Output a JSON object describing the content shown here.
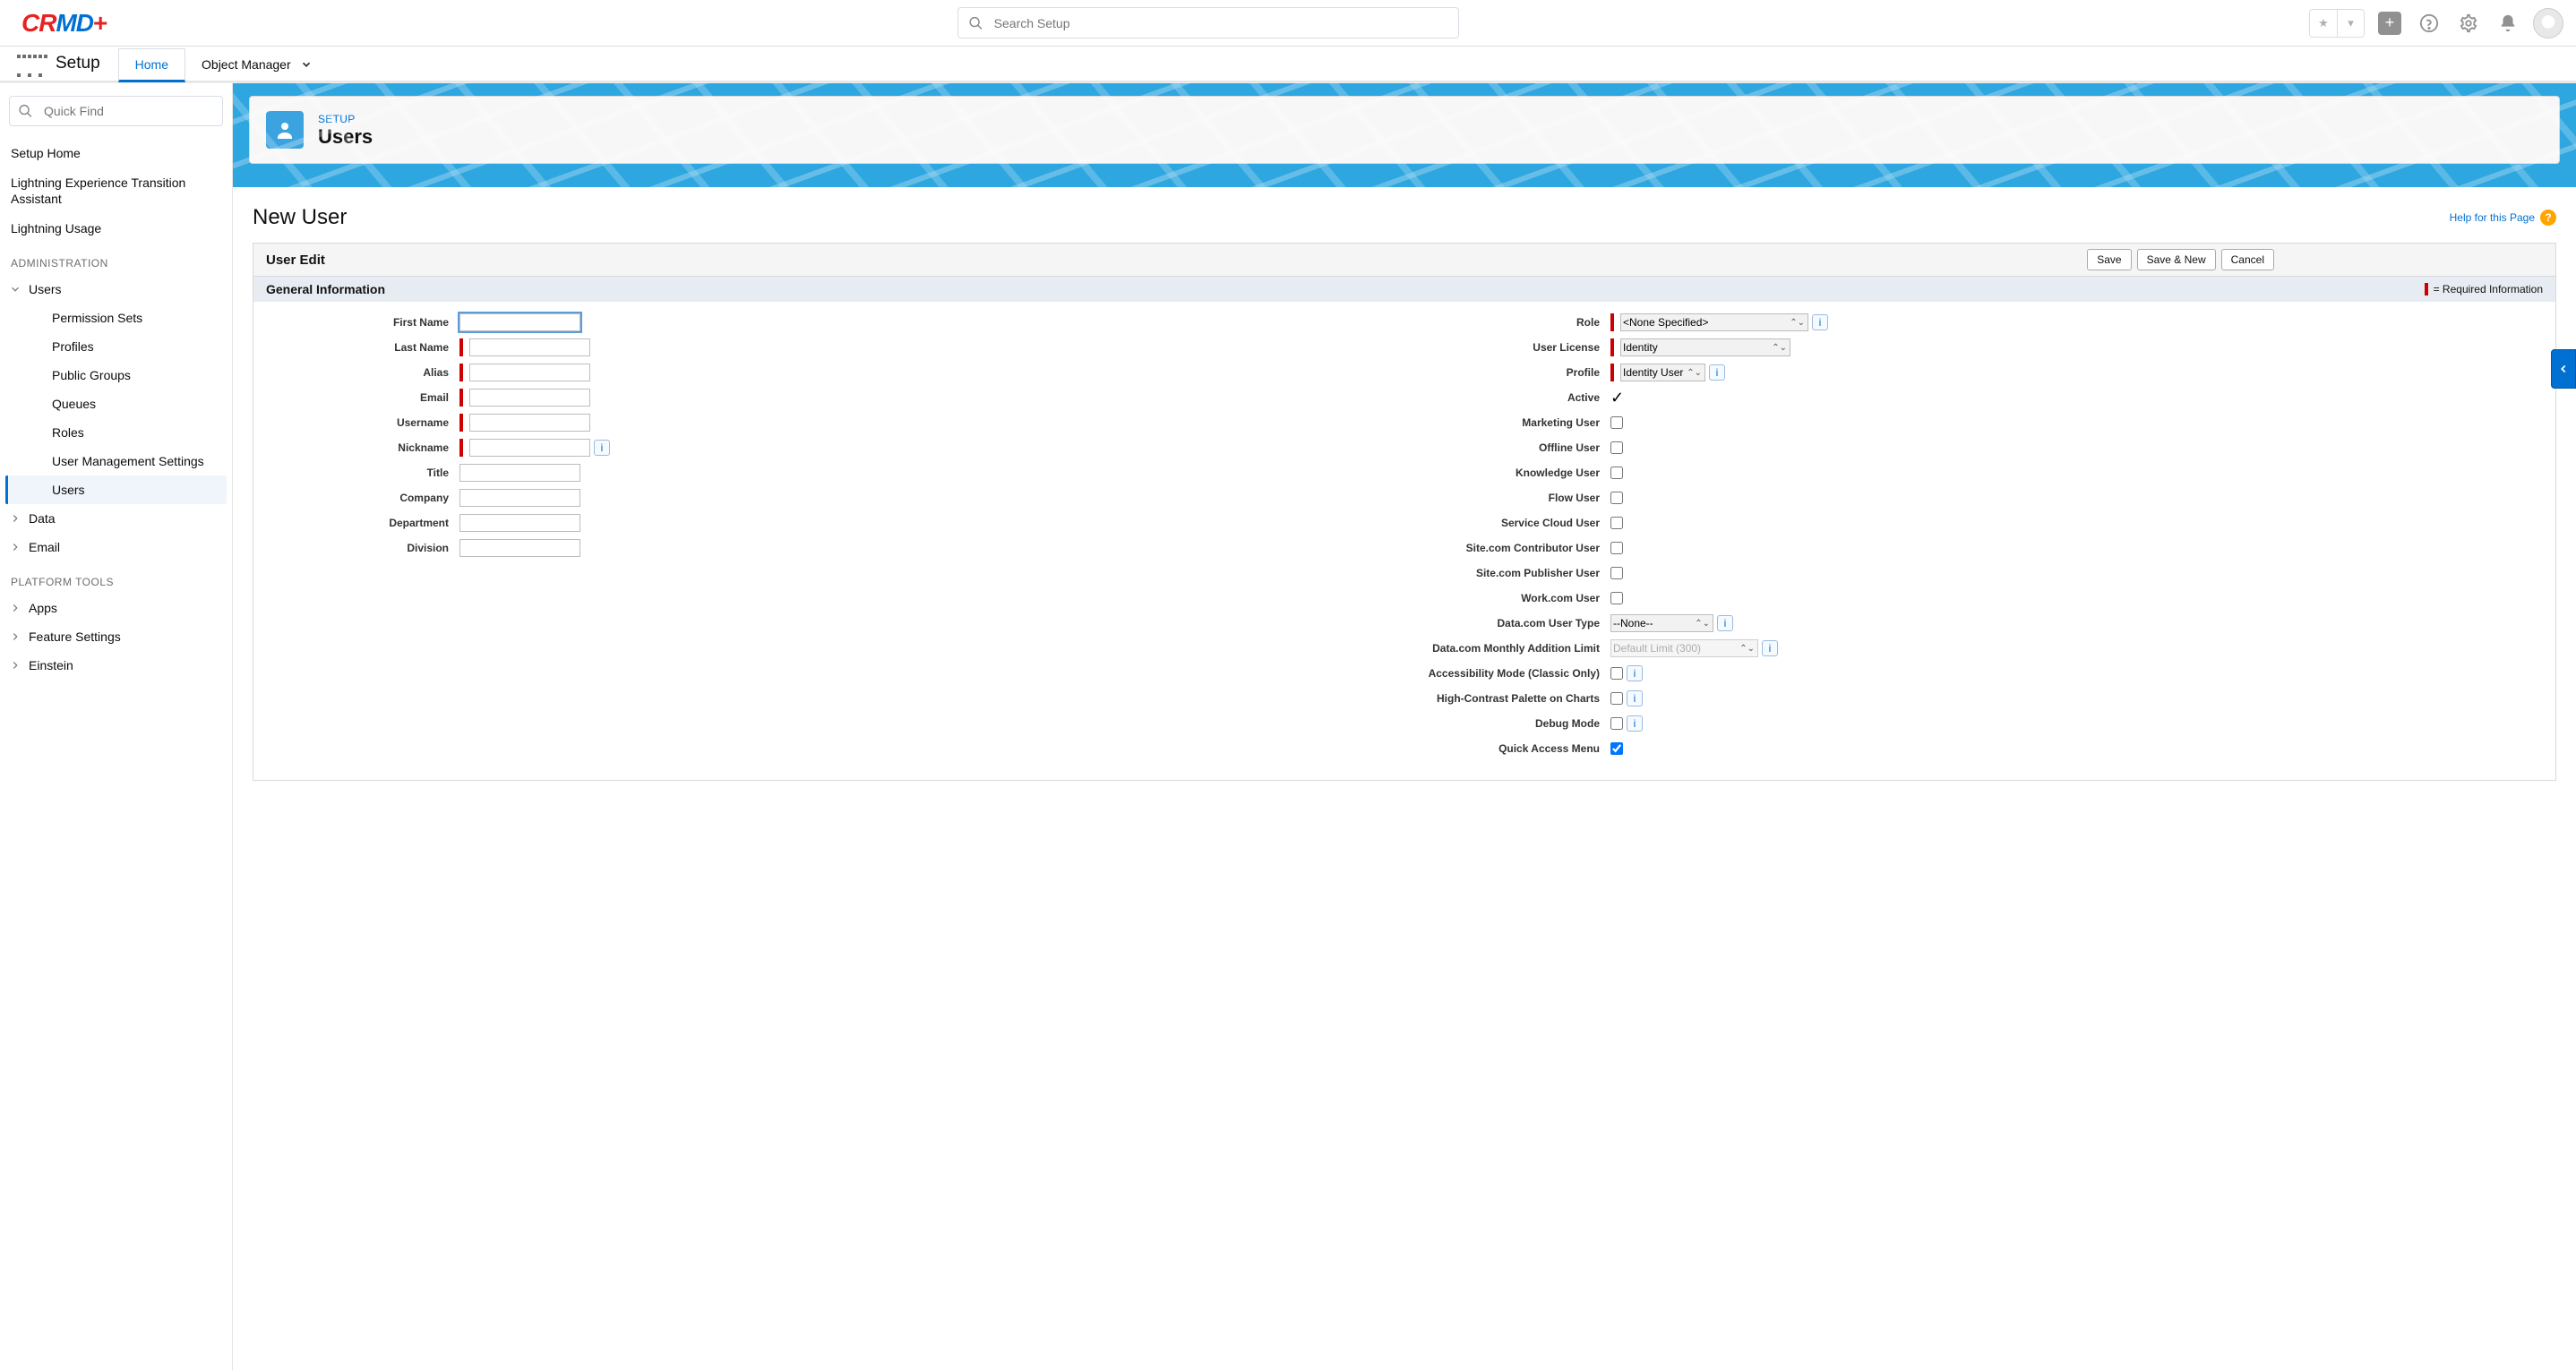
{
  "header": {
    "search_placeholder": "Search Setup"
  },
  "appbar": {
    "setup": "Setup",
    "home": "Home",
    "obj_mgr": "Object Manager"
  },
  "sidebar": {
    "quick_find": "Quick Find",
    "setup_home": "Setup Home",
    "lightning_transition": "Lightning Experience Transition Assistant",
    "lightning_usage": "Lightning Usage",
    "admin_label": "ADMINISTRATION",
    "users": "Users",
    "perms": "Permission Sets",
    "profiles": "Profiles",
    "public_groups": "Public Groups",
    "queues": "Queues",
    "roles": "Roles",
    "ums": "User Management Settings",
    "users_active": "Users",
    "data": "Data",
    "email": "Email",
    "platform_label": "PLATFORM TOOLS",
    "apps": "Apps",
    "feature": "Feature Settings",
    "einstein": "Einstein"
  },
  "banner": {
    "crumb": "SETUP",
    "title": "Users"
  },
  "page": {
    "title": "New User",
    "help": "Help for this Page",
    "panel_title": "User Edit",
    "save": "Save",
    "save_new": "Save & New",
    "cancel": "Cancel",
    "section": "General Information",
    "required": "= Required Information"
  },
  "left_fields": {
    "first_name": "First Name",
    "last_name": "Last Name",
    "alias": "Alias",
    "email": "Email",
    "username": "Username",
    "nickname": "Nickname",
    "title": "Title",
    "company": "Company",
    "department": "Department",
    "division": "Division"
  },
  "right_fields": {
    "role": "Role",
    "role_val": "<None Specified>",
    "license": "User License",
    "license_val": "Identity",
    "profile": "Profile",
    "profile_val": "Identity User",
    "active": "Active",
    "marketing": "Marketing User",
    "offline": "Offline User",
    "knowledge": "Knowledge User",
    "flow": "Flow User",
    "scu": "Service Cloud User",
    "site_contrib": "Site.com Contributor User",
    "site_pub": "Site.com Publisher User",
    "work": "Work.com User",
    "dc_type": "Data.com User Type",
    "dc_type_val": "--None--",
    "dc_limit": "Data.com Monthly Addition Limit",
    "dc_limit_val": "Default Limit (300)",
    "accessibility": "Accessibility Mode (Classic Only)",
    "contrast": "High-Contrast Palette on Charts",
    "debug": "Debug Mode",
    "quick_access": "Quick Access Menu"
  }
}
